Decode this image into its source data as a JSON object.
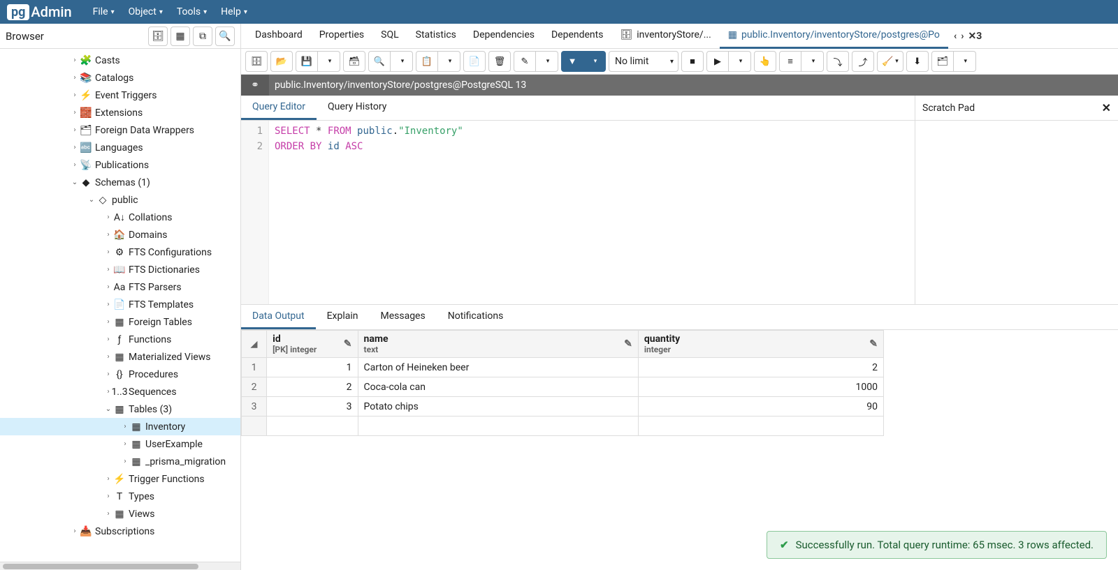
{
  "app": {
    "logo_prefix": "pg",
    "logo_text": "Admin"
  },
  "menubar": [
    {
      "label": "File"
    },
    {
      "label": "Object"
    },
    {
      "label": "Tools"
    },
    {
      "label": "Help"
    }
  ],
  "sidebar": {
    "title": "Browser",
    "tree": [
      {
        "indent": 100,
        "expanded": false,
        "icon": "🧩",
        "label": "Casts"
      },
      {
        "indent": 100,
        "expanded": false,
        "icon": "📚",
        "label": "Catalogs"
      },
      {
        "indent": 100,
        "expanded": false,
        "icon": "⚡",
        "label": "Event Triggers"
      },
      {
        "indent": 100,
        "expanded": false,
        "icon": "🧱",
        "label": "Extensions"
      },
      {
        "indent": 100,
        "expanded": false,
        "icon": "🗂",
        "label": "Foreign Data Wrappers"
      },
      {
        "indent": 100,
        "expanded": false,
        "icon": "🔤",
        "label": "Languages"
      },
      {
        "indent": 100,
        "expanded": false,
        "icon": "📡",
        "label": "Publications"
      },
      {
        "indent": 100,
        "expanded": true,
        "icon": "◆",
        "label": "Schemas (1)"
      },
      {
        "indent": 124,
        "expanded": true,
        "icon": "◇",
        "label": "public"
      },
      {
        "indent": 148,
        "expanded": false,
        "icon": "A↓",
        "label": "Collations"
      },
      {
        "indent": 148,
        "expanded": false,
        "icon": "🏠",
        "label": "Domains"
      },
      {
        "indent": 148,
        "expanded": false,
        "icon": "⚙",
        "label": "FTS Configurations"
      },
      {
        "indent": 148,
        "expanded": false,
        "icon": "📖",
        "label": "FTS Dictionaries"
      },
      {
        "indent": 148,
        "expanded": false,
        "icon": "Aa",
        "label": "FTS Parsers"
      },
      {
        "indent": 148,
        "expanded": false,
        "icon": "📄",
        "label": "FTS Templates"
      },
      {
        "indent": 148,
        "expanded": false,
        "icon": "▦",
        "label": "Foreign Tables"
      },
      {
        "indent": 148,
        "expanded": false,
        "icon": "ƒ",
        "label": "Functions"
      },
      {
        "indent": 148,
        "expanded": false,
        "icon": "▦",
        "label": "Materialized Views"
      },
      {
        "indent": 148,
        "expanded": false,
        "icon": "{}",
        "label": "Procedures"
      },
      {
        "indent": 148,
        "expanded": false,
        "icon": "1..3",
        "label": "Sequences"
      },
      {
        "indent": 148,
        "expanded": true,
        "icon": "▦",
        "label": "Tables (3)"
      },
      {
        "indent": 172,
        "expanded": false,
        "icon": "▦",
        "label": "Inventory",
        "selected": true
      },
      {
        "indent": 172,
        "expanded": false,
        "icon": "▦",
        "label": "UserExample"
      },
      {
        "indent": 172,
        "expanded": false,
        "icon": "▦",
        "label": "_prisma_migration"
      },
      {
        "indent": 148,
        "expanded": false,
        "icon": "⚡",
        "label": "Trigger Functions"
      },
      {
        "indent": 148,
        "expanded": false,
        "icon": "T",
        "label": "Types"
      },
      {
        "indent": 148,
        "expanded": false,
        "icon": "▦",
        "label": "Views"
      },
      {
        "indent": 100,
        "expanded": false,
        "icon": "📥",
        "label": "Subscriptions"
      }
    ]
  },
  "main_tabs": [
    {
      "label": "Dashboard"
    },
    {
      "label": "Properties"
    },
    {
      "label": "SQL"
    },
    {
      "label": "Statistics"
    },
    {
      "label": "Dependencies"
    },
    {
      "label": "Dependents"
    },
    {
      "label": "inventoryStore/...",
      "icon": "db",
      "closable": false
    },
    {
      "label": "public.Inventory/inventoryStore/postgres@Po",
      "icon": "table",
      "active": true,
      "closable": false
    }
  ],
  "tabs_overflow_close": "✕3",
  "toolbar": {
    "limit": "No limit"
  },
  "connection": {
    "text": "public.Inventory/inventoryStore/postgres@PostgreSQL 13"
  },
  "editor_tabs": [
    {
      "label": "Query Editor",
      "active": true
    },
    {
      "label": "Query History"
    }
  ],
  "scratch_pad_title": "Scratch Pad",
  "code_lines": [
    "1",
    "2"
  ],
  "sql": {
    "line1": {
      "kw1": "SELECT",
      "star": "*",
      "kw2": "FROM",
      "schema": "public",
      "str": "\"Inventory\""
    },
    "line2": {
      "kw1": "ORDER",
      "kw2": "BY",
      "col": "id",
      "kw3": "ASC"
    }
  },
  "output_tabs": [
    {
      "label": "Data Output",
      "active": true
    },
    {
      "label": "Explain"
    },
    {
      "label": "Messages"
    },
    {
      "label": "Notifications"
    }
  ],
  "grid": {
    "columns": [
      {
        "name": "id",
        "type": "[PK] integer"
      },
      {
        "name": "name",
        "type": "text"
      },
      {
        "name": "quantity",
        "type": "integer"
      }
    ],
    "rows": [
      {
        "n": "1",
        "id": "1",
        "name": "Carton of Heineken beer",
        "quantity": "2"
      },
      {
        "n": "2",
        "id": "2",
        "name": "Coca-cola can",
        "quantity": "1000"
      },
      {
        "n": "3",
        "id": "3",
        "name": "Potato chips",
        "quantity": "90"
      }
    ]
  },
  "status": "Successfully run. Total query runtime: 65 msec. 3 rows affected."
}
